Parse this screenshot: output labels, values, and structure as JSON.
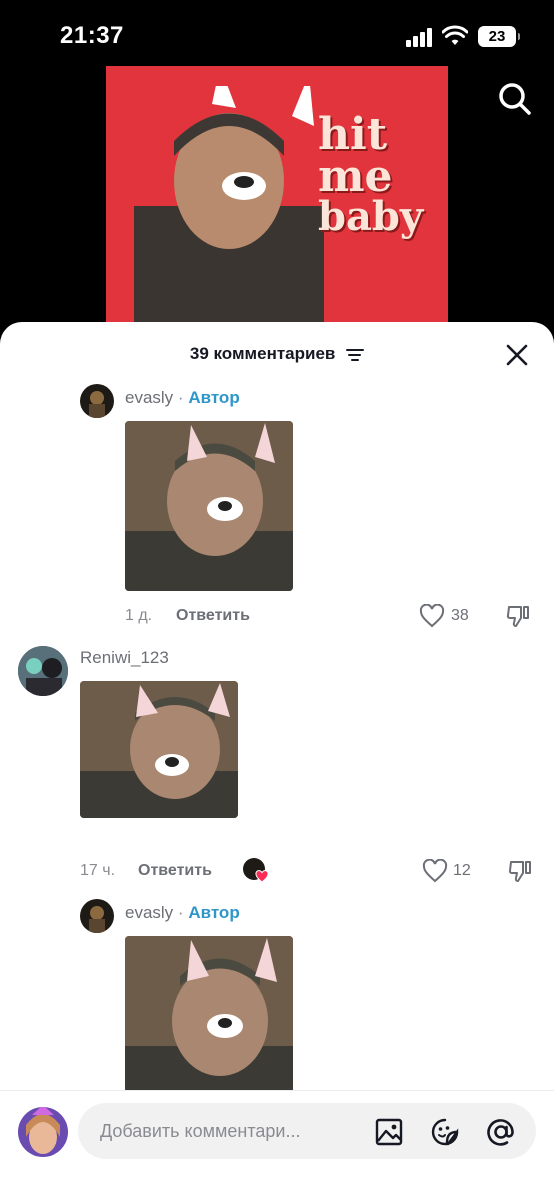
{
  "status_bar": {
    "time": "21:37",
    "battery": "23"
  },
  "video": {
    "overlay_text": [
      "hit",
      "me",
      "baby"
    ]
  },
  "comments_header": {
    "title": "39 комментариев"
  },
  "comments": [
    {
      "username": "evasly",
      "separator": "·",
      "badge": "Автор",
      "time": "1 д.",
      "reply_label": "Ответить",
      "likes": "38"
    },
    {
      "username": "Reniwi_123",
      "time": "17 ч.",
      "reply_label": "Ответить",
      "likes": "12"
    },
    {
      "username": "evasly",
      "separator": "·",
      "badge": "Автор"
    }
  ],
  "composer": {
    "placeholder": "Добавить комментари..."
  },
  "icons": [
    "search-icon",
    "filter-icon",
    "close-icon",
    "heart-icon",
    "dislike-icon",
    "image-icon",
    "sticker-icon",
    "mention-icon"
  ],
  "colors": {
    "accent_author": "#2f96c8",
    "video_bg": "#e2343c",
    "like_heart": "#fe2c55"
  }
}
